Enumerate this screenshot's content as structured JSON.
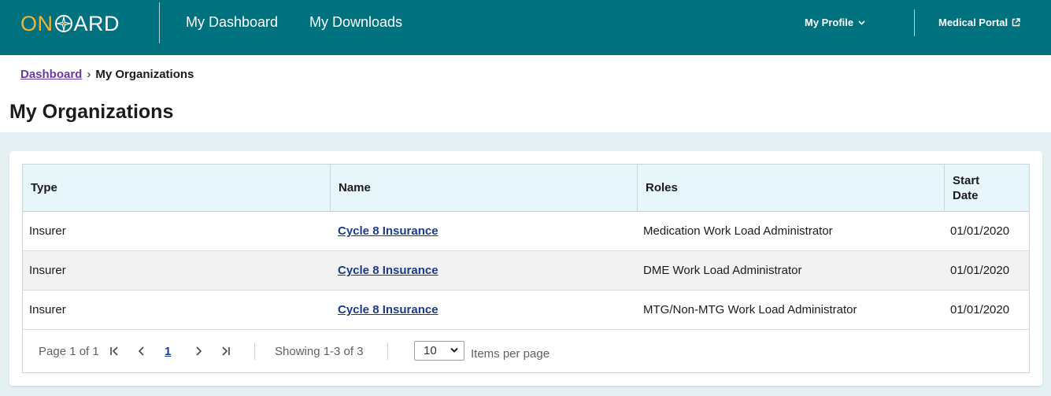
{
  "header": {
    "logo": {
      "part1": "ON",
      "part2": "ARD"
    },
    "nav": [
      {
        "label": "My Dashboard"
      },
      {
        "label": "My Downloads"
      }
    ],
    "profile_label": "My Profile",
    "portal_label": "Medical Portal"
  },
  "breadcrumb": {
    "parent": "Dashboard",
    "separator": "›",
    "current": "My Organizations"
  },
  "page_title": "My Organizations",
  "table": {
    "columns": [
      "Type",
      "Name",
      "Roles",
      "Start Date"
    ],
    "rows": [
      {
        "type": "Insurer",
        "name": "Cycle 8 Insurance",
        "role": "Medication Work Load Administrator",
        "start_date": "01/01/2020"
      },
      {
        "type": "Insurer",
        "name": "Cycle 8 Insurance",
        "role": "DME Work Load Administrator",
        "start_date": "01/01/2020"
      },
      {
        "type": "Insurer",
        "name": "Cycle 8 Insurance",
        "role": "MTG/Non-MTG Work Load Administrator",
        "start_date": "01/01/2020"
      }
    ]
  },
  "pagination": {
    "page_info": "Page 1 of 1",
    "current_page": "1",
    "showing": "Showing 1-3 of 3",
    "per_page_value": "10",
    "per_page_label": "Items per page"
  },
  "colors": {
    "header_bg": "#00717f",
    "logo_accent": "#f2b531",
    "link": "#1a3a8c",
    "breadcrumb_link": "#6a3aa0",
    "table_header_bg": "#e7f6fa",
    "page_bg": "#e4f0f1"
  }
}
